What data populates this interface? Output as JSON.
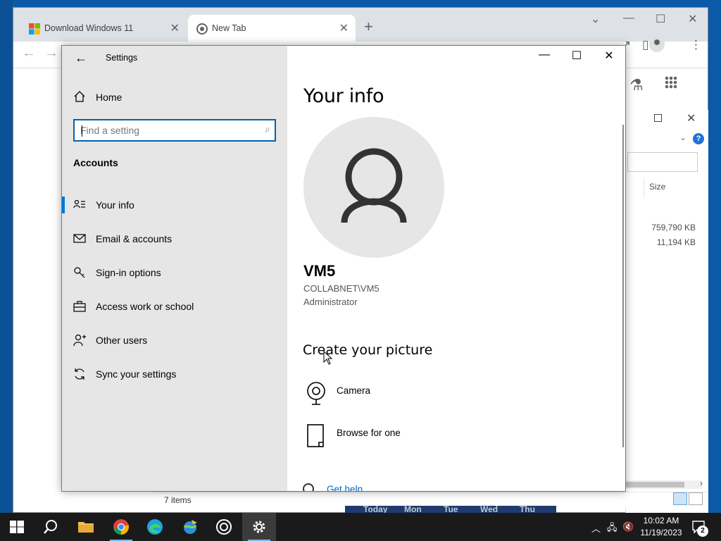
{
  "browser": {
    "tabs": [
      {
        "title": "Download Windows 11",
        "active": false
      },
      {
        "title": "New Tab",
        "active": true
      }
    ],
    "new_tab_icon": "plus-icon"
  },
  "explorer": {
    "column_header": "Size",
    "sizes": [
      "759,790 KB",
      "11,194 KB"
    ],
    "status": "7 items"
  },
  "calendar_days": [
    "Today",
    "Mon",
    "Tue",
    "Wed",
    "Thu"
  ],
  "settings": {
    "app_title": "Settings",
    "home_label": "Home",
    "search_placeholder": "Find a setting",
    "section_title": "Accounts",
    "nav_items": [
      {
        "label": "Your info",
        "icon": "contact-card-icon",
        "selected": true
      },
      {
        "label": "Email & accounts",
        "icon": "mail-icon",
        "selected": false
      },
      {
        "label": "Sign-in options",
        "icon": "key-icon",
        "selected": false
      },
      {
        "label": "Access work or school",
        "icon": "briefcase-icon",
        "selected": false
      },
      {
        "label": "Other users",
        "icon": "add-person-icon",
        "selected": false
      },
      {
        "label": "Sync your settings",
        "icon": "sync-icon",
        "selected": false
      }
    ],
    "page_title": "Your info",
    "user": {
      "name": "VM5",
      "account": "COLLABNET\\VM5",
      "role": "Administrator"
    },
    "create_picture_title": "Create your picture",
    "picture_options": [
      {
        "label": "Camera",
        "icon": "camera-icon"
      },
      {
        "label": "Browse for one",
        "icon": "file-icon"
      }
    ],
    "help_link": "Get help"
  },
  "taskbar": {
    "apps": [
      "start",
      "search",
      "file-explorer",
      "chrome",
      "edge",
      "network-app",
      "media-app",
      "settings"
    ],
    "time": "10:02 AM",
    "date": "11/19/2023",
    "notification_count": "2"
  },
  "colors": {
    "accent": "#0078d7",
    "link": "#0066cc",
    "nav_bg": "#e6e6e6",
    "taskbar_bg": "#1a1a1a"
  }
}
